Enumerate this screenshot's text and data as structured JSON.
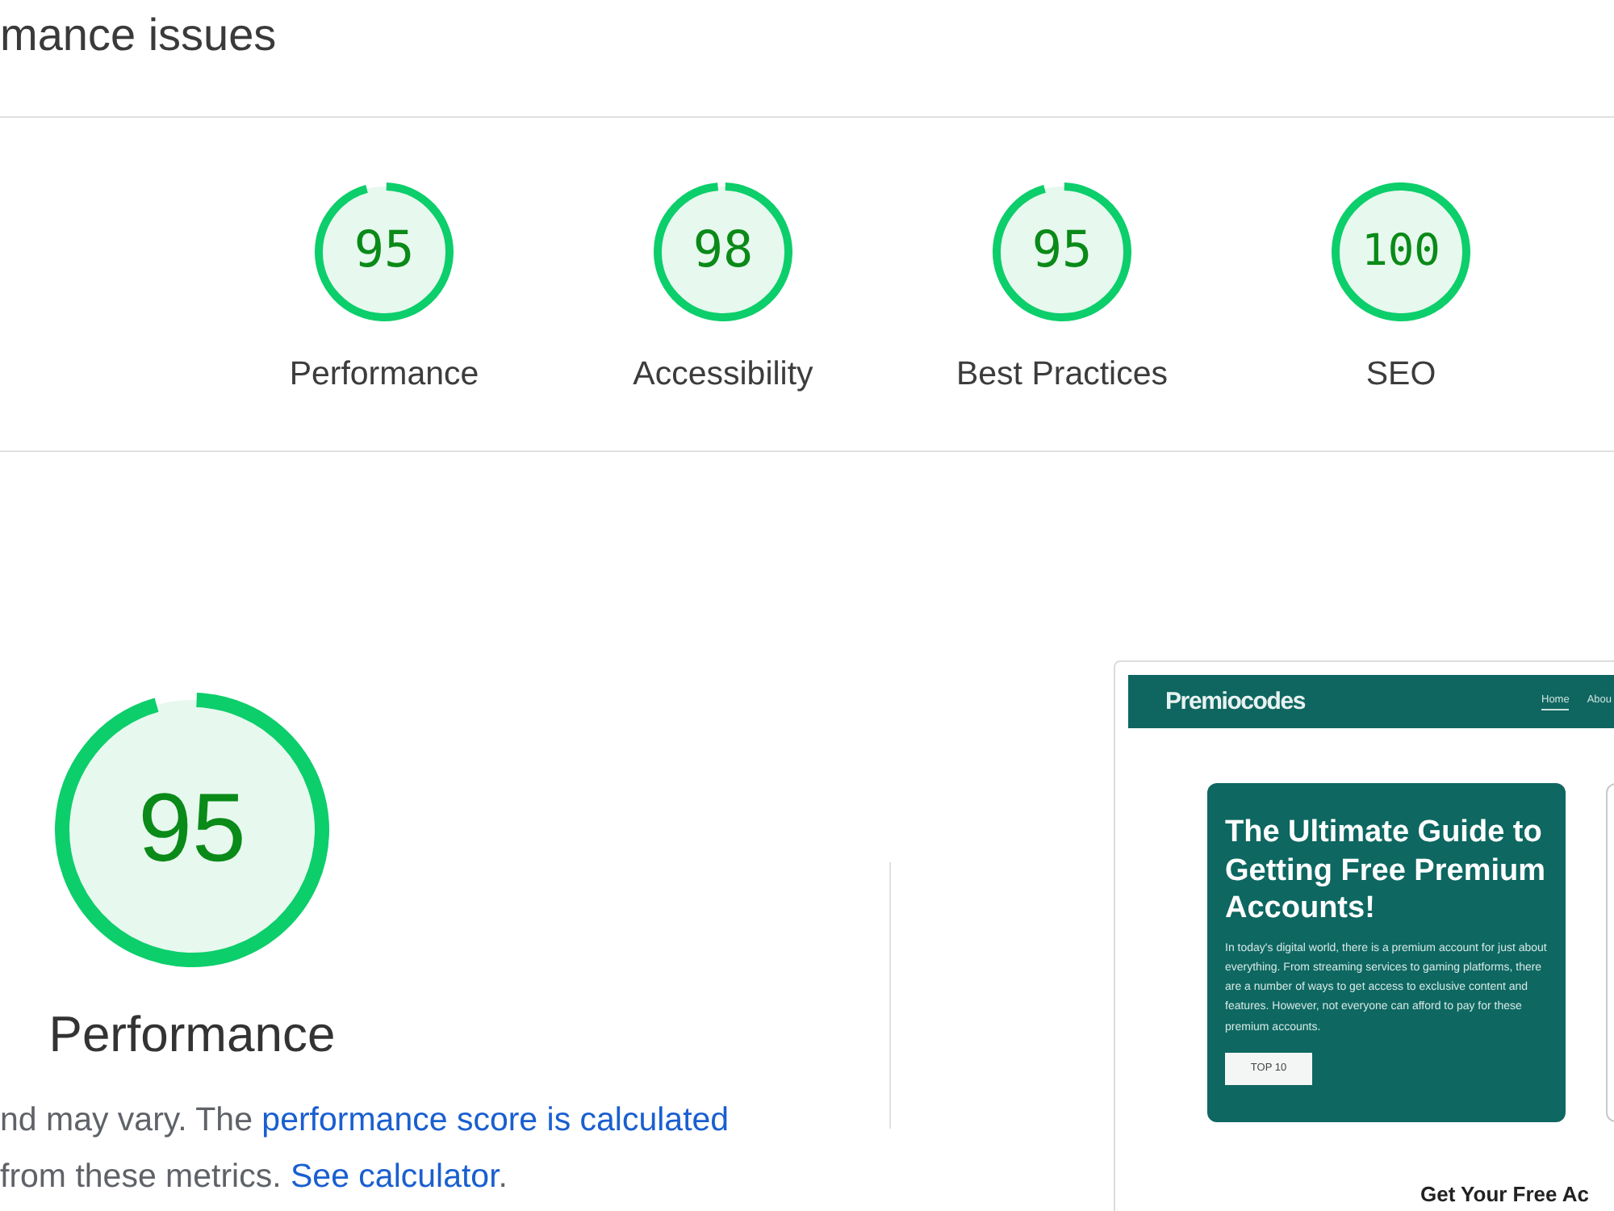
{
  "header": {
    "title": "mance issues"
  },
  "categories": [
    {
      "score": "95",
      "label": "Performance",
      "level": 0.95
    },
    {
      "score": "98",
      "label": "Accessibility",
      "level": 0.98
    },
    {
      "score": "95",
      "label": "Best Practices",
      "level": 0.95
    },
    {
      "score": "100",
      "label": "SEO",
      "level": 1
    }
  ],
  "performance": {
    "score": "95",
    "level": 0.95,
    "title": "Performance",
    "description": [
      {
        "kind": "text",
        "text": "nd may vary. The "
      },
      {
        "kind": "link",
        "text": "performance score is calculated"
      },
      {
        "kind": "text",
        "text": " from these metrics. "
      },
      {
        "kind": "link",
        "text": "See calculator"
      },
      {
        "kind": "text",
        "text": "."
      }
    ]
  },
  "screenshot": {
    "brand": "Premiocodes",
    "nav": [
      {
        "label": "Home",
        "selected": true
      },
      {
        "label": "Abou",
        "selected": false
      }
    ],
    "hero": {
      "title": "The Ultimate Guide to Getting Free Premium Accounts!",
      "body": "In today's digital world, there is a premium account for just about everything. From streaming services to gaming platforms, there are a number of ways to get access to exclusive content and features. However, not everyone can afford to pay for these premium accounts.",
      "button": "TOP 10"
    },
    "section_heading": "Get Your Free Ac"
  }
}
